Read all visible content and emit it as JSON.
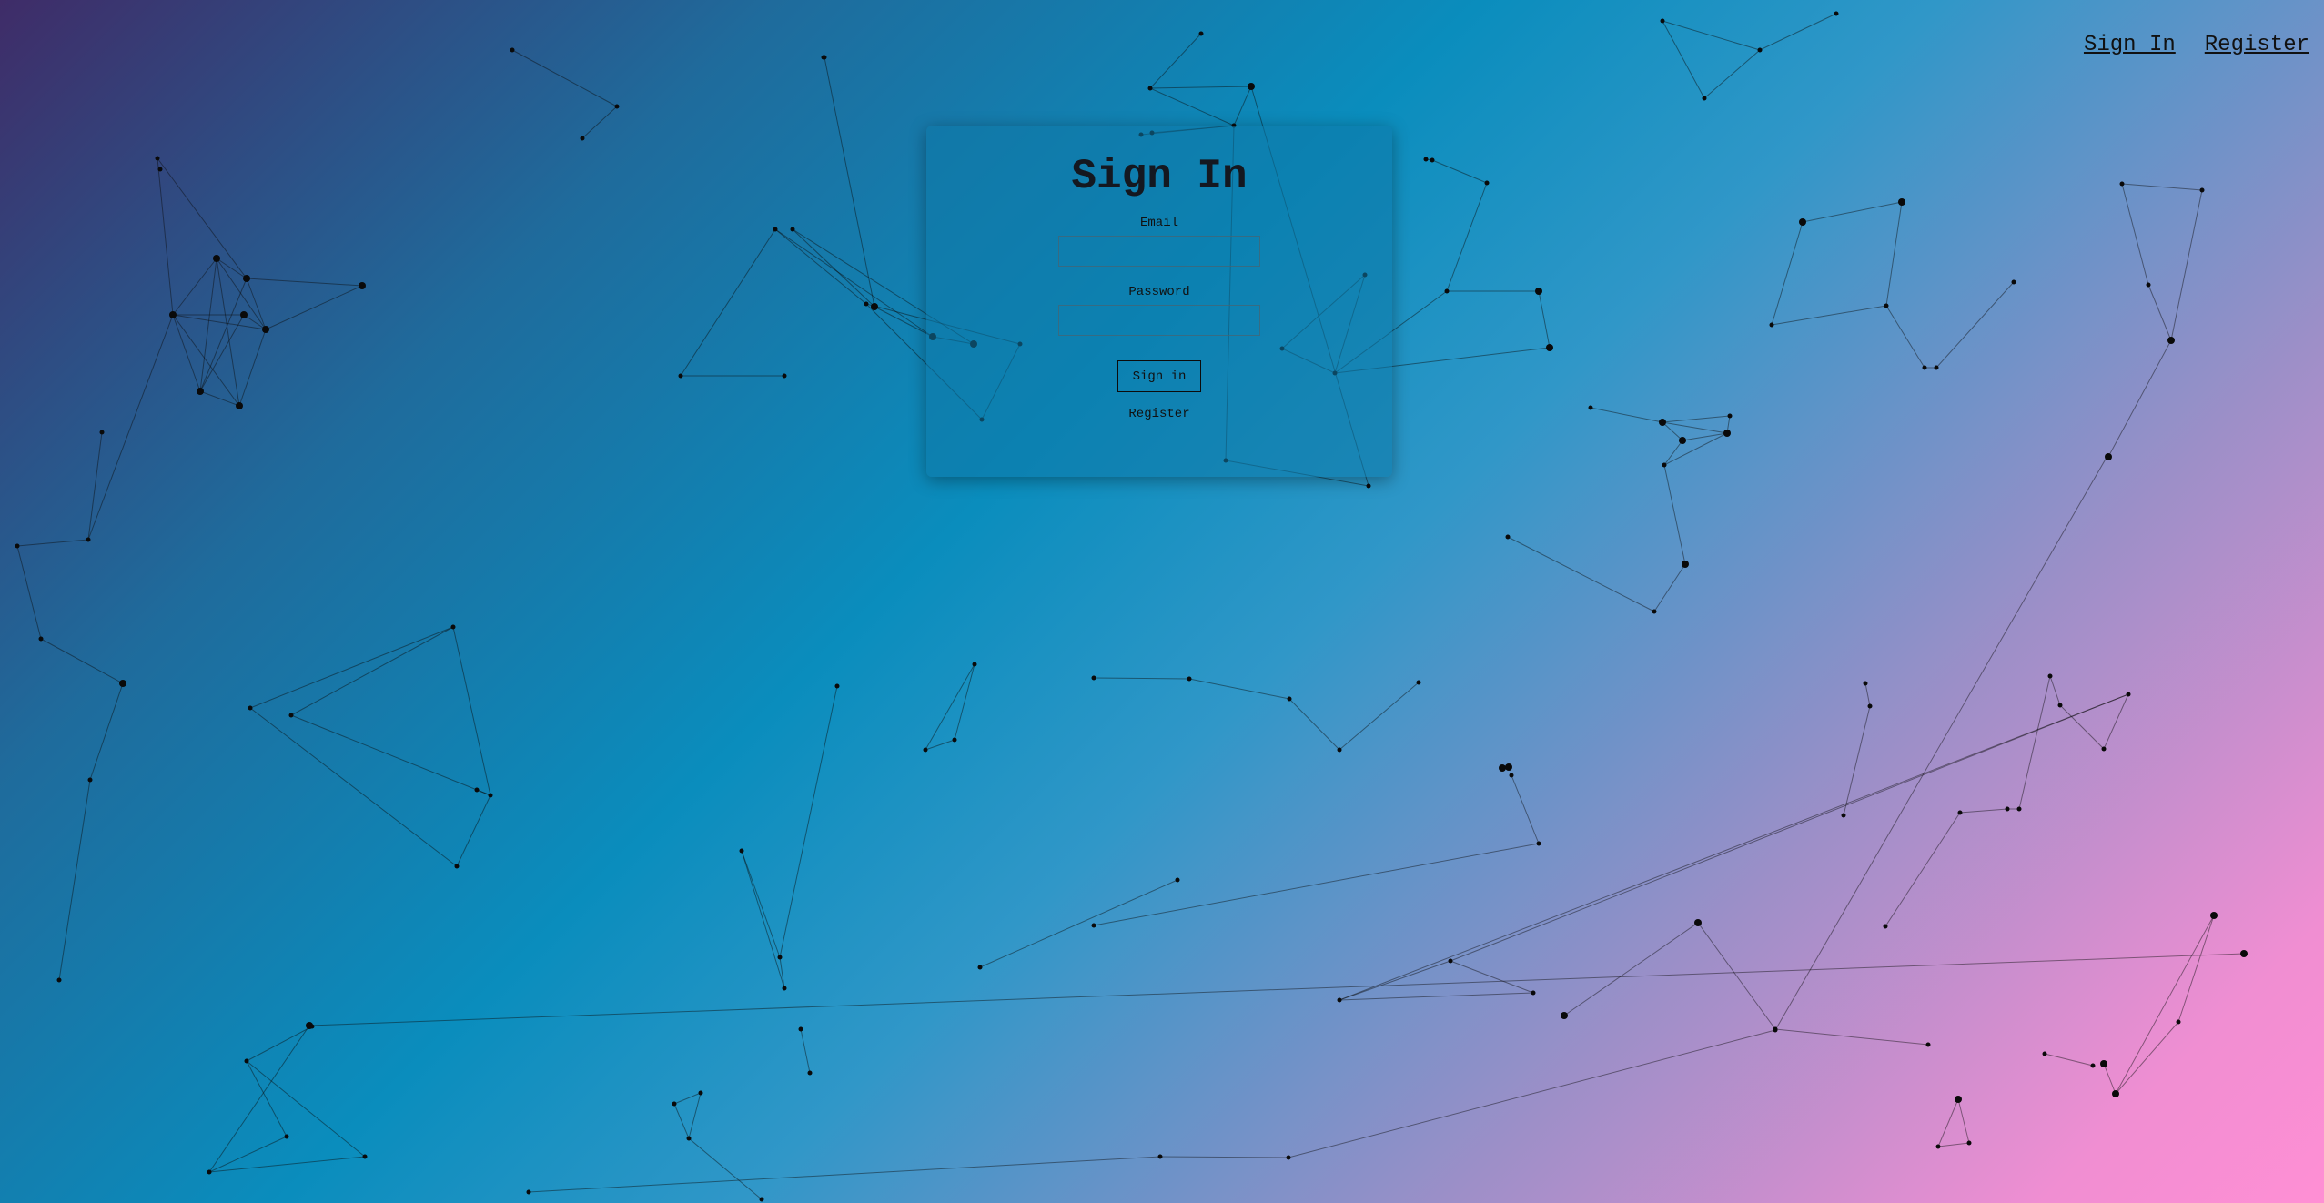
{
  "nav": {
    "sign_in": "Sign In",
    "register": "Register"
  },
  "form": {
    "title": "Sign In",
    "email_label": "Email",
    "email_value": "",
    "password_label": "Password",
    "password_value": "",
    "submit_label": "Sign in",
    "register_link": "Register"
  },
  "colors": {
    "gradient_start": "#3f2c68",
    "gradient_mid": "#0a8dbd",
    "gradient_end": "#ff8fd4",
    "node_color": "#0a0a0a"
  }
}
